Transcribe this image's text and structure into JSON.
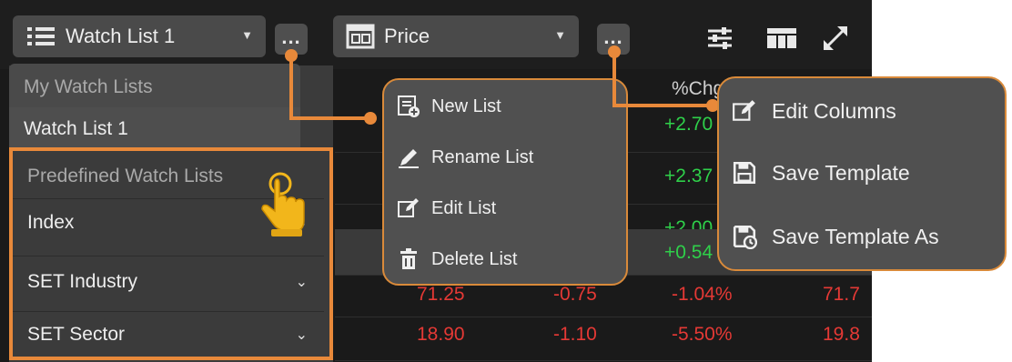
{
  "toolbar": {
    "watchlist_select": "Watch List 1",
    "view_select": "Price",
    "more_label": "..."
  },
  "table": {
    "header_pct_change": "%Chg",
    "rows": [
      {
        "pct": "+2.70"
      },
      {
        "pct": "+2.37"
      },
      {
        "pct": "+2.00"
      },
      {
        "pct": "+0.54"
      },
      {
        "last": "71.25",
        "change": "-0.75",
        "pct": "-1.04%",
        "prev": "71.7"
      },
      {
        "last": "18.90",
        "change": "-1.10",
        "pct": "-5.50%",
        "prev": "19.8"
      }
    ]
  },
  "watchlist_dropdown": {
    "my_header": "My Watch Lists",
    "my_items": [
      "Watch List 1"
    ],
    "predefined_header": "Predefined Watch Lists",
    "predefined_items": [
      "Index",
      "SET Industry",
      "SET Sector"
    ]
  },
  "list_menu": {
    "items": [
      "New List",
      "Rename List",
      "Edit List",
      "Delete List"
    ]
  },
  "template_menu": {
    "items": [
      "Edit Columns",
      "Save Template",
      "Save Template As"
    ]
  },
  "colors": {
    "accent": "#e8893a",
    "positive": "#2fd04a",
    "negative": "#e53935"
  }
}
